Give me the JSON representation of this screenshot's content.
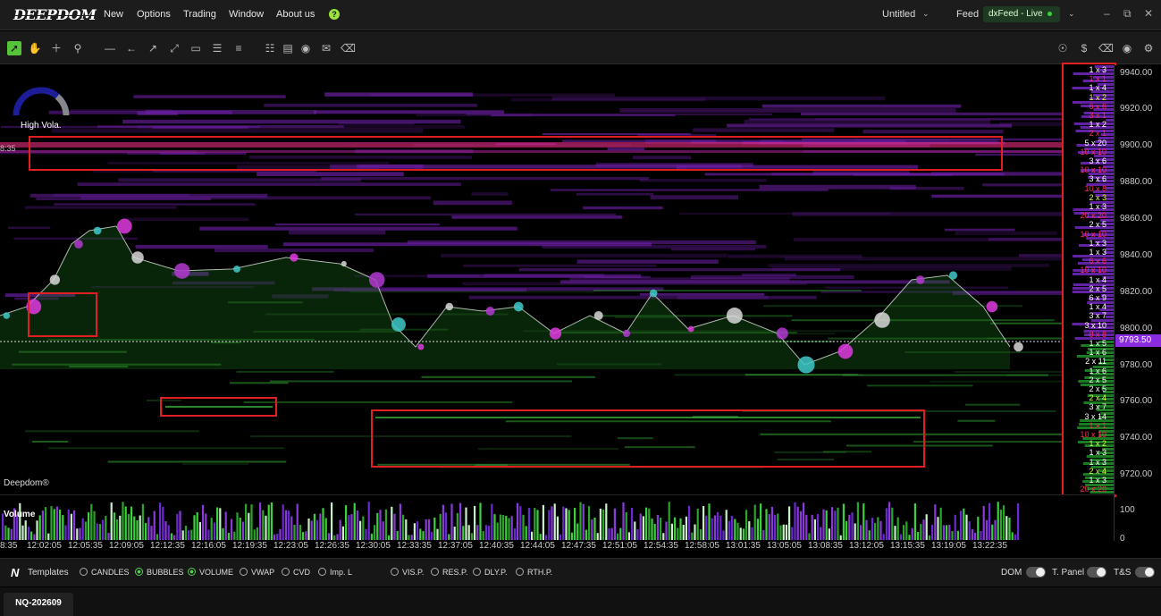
{
  "app": {
    "logo": "DEEPDOM"
  },
  "menu": {
    "items": [
      "New",
      "Options",
      "Trading",
      "Window",
      "About us"
    ],
    "help_icon": "question-circle-icon"
  },
  "header": {
    "workspace": "Untitled",
    "feed_label": "Feed",
    "feed_value": "dxFeed - Live"
  },
  "toolbar": {
    "left_tools": [
      "cursor-icon",
      "hand-icon",
      "crosshair-icon",
      "zoom-icon",
      "horizontal-line-icon",
      "ray-icon",
      "trend-line-icon",
      "ruler-icon",
      "rectangle-icon",
      "align-icon",
      "menu-icon",
      "settings-sliders-icon",
      "bar-chart-icon",
      "bomb-icon",
      "comment-icon",
      "eraser-icon"
    ],
    "right_tools": [
      "camera-icon",
      "dollar-icon",
      "eraser-icon",
      "record-icon",
      "gear-icon"
    ]
  },
  "chart": {
    "volatility_label": "High Vola.",
    "watermark": "Deepdom®",
    "current_price": "9793.50",
    "left_time_partial": "8:35",
    "colors": {
      "ask": "#b53ad9",
      "bid": "#2aa52a",
      "level_pink": "#ff2f8a",
      "price_line": "#ffffff",
      "box": "#e02020"
    }
  },
  "price_axis": {
    "ticks": [
      "9940.00",
      "9920.00",
      "9900.00",
      "9880.00",
      "9860.00",
      "9840.00",
      "9820.00",
      "9800.00",
      "9780.00",
      "9760.00",
      "9740.00",
      "9720.00"
    ]
  },
  "dom_ladder": [
    {
      "text": "1 x 3",
      "c": "w"
    },
    {
      "text": "1 x 1",
      "c": "r"
    },
    {
      "text": "1 x 4",
      "c": "w"
    },
    {
      "text": "1 x 2",
      "c": "y"
    },
    {
      "text": "6 x 6",
      "c": "r"
    },
    {
      "text": "3 x 1",
      "c": "r"
    },
    {
      "text": "1 x 2",
      "c": "w"
    },
    {
      "text": "2 x 1",
      "c": "r"
    },
    {
      "text": "5 x 20",
      "c": "w"
    },
    {
      "text": "10 x 10",
      "c": "r"
    },
    {
      "text": "3 x 6",
      "c": "w"
    },
    {
      "text": "10 x 10",
      "c": "r"
    },
    {
      "text": "3 x 6",
      "c": "w"
    },
    {
      "text": "10 x 8",
      "c": "r"
    },
    {
      "text": "2 x 3",
      "c": "y"
    },
    {
      "text": "1 x 3",
      "c": "w"
    },
    {
      "text": "20 x 20",
      "c": "r"
    },
    {
      "text": "2 x 5",
      "c": "w"
    },
    {
      "text": "10 x 10",
      "c": "r"
    },
    {
      "text": "1 x 3",
      "c": "w"
    },
    {
      "text": "1 x 3",
      "c": "w"
    },
    {
      "text": "6 x 6",
      "c": "r"
    },
    {
      "text": "10 x 10",
      "c": "r"
    },
    {
      "text": "1 x 4",
      "c": "w"
    },
    {
      "text": "2 x 5",
      "c": "w"
    },
    {
      "text": "6 x 9",
      "c": "w"
    },
    {
      "text": "1 x 4",
      "c": "w"
    },
    {
      "text": "3 x 7",
      "c": "w"
    },
    {
      "text": "3 x 10",
      "c": "w"
    },
    {
      "text": "8 x 8",
      "c": "r"
    },
    {
      "text": "1 x 5",
      "c": "w"
    },
    {
      "text": "1 x 6",
      "c": "w"
    },
    {
      "text": "2 x 11",
      "c": "w"
    },
    {
      "text": "1 x 6",
      "c": "w"
    },
    {
      "text": "2 x 5",
      "c": "w"
    },
    {
      "text": "2 x 5",
      "c": "w"
    },
    {
      "text": "2 x 4",
      "c": "y"
    },
    {
      "text": "3 x 7",
      "c": "w"
    },
    {
      "text": "3 x 14",
      "c": "w"
    },
    {
      "text": "1 x 1",
      "c": "r"
    },
    {
      "text": "10 x 10",
      "c": "r"
    },
    {
      "text": "1 x 2",
      "c": "y"
    },
    {
      "text": "1 x 3",
      "c": "w"
    },
    {
      "text": "1 x 3",
      "c": "w"
    },
    {
      "text": "2 x 4",
      "c": "y"
    },
    {
      "text": "1 x 3",
      "c": "w"
    },
    {
      "text": "20 x 20",
      "c": "r"
    }
  ],
  "volume_panel": {
    "label": "Volume",
    "axis": [
      "100",
      "0"
    ]
  },
  "time_axis": [
    "12:02:05",
    "12:05:35",
    "12:09:05",
    "12:12:35",
    "12:16:05",
    "12:19:35",
    "12:23:05",
    "12:26:35",
    "12:30:05",
    "12:33:35",
    "12:37:05",
    "12:40:35",
    "12:44:05",
    "12:47:35",
    "12:51:05",
    "12:54:35",
    "12:58:05",
    "13:01:35",
    "13:05:05",
    "13:08:35",
    "13:12:05",
    "13:15:35",
    "13:19:05",
    "13:22:35"
  ],
  "bottom_bar": {
    "templates_label": "Templates",
    "options": [
      {
        "label": "CANDLES",
        "on": false
      },
      {
        "label": "BUBBLES",
        "on": true
      },
      {
        "label": "VOLUME",
        "on": true
      },
      {
        "label": "VWAP",
        "on": false
      },
      {
        "label": "CVD",
        "on": false
      },
      {
        "label": "Imp. L",
        "on": false
      },
      {
        "label": "VIS.P.",
        "on": false
      },
      {
        "label": "RES.P.",
        "on": false
      },
      {
        "label": "DLY.P.",
        "on": false
      },
      {
        "label": "RTH.P.",
        "on": false
      }
    ],
    "toggles": [
      "DOM",
      "T. Panel",
      "T&S"
    ]
  },
  "tabs": [
    "NQ-202609"
  ]
}
